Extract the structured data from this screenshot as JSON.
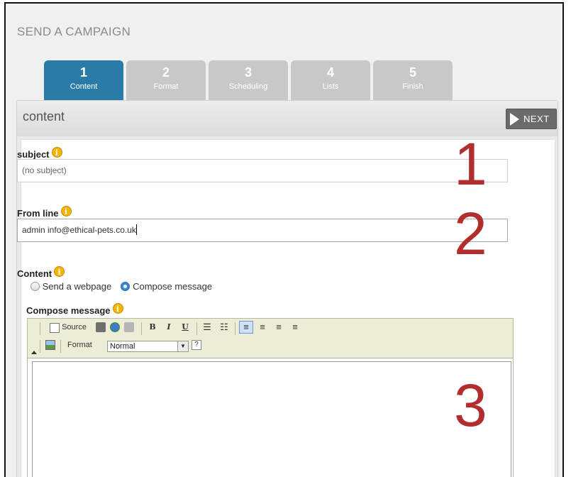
{
  "page": {
    "title": "SEND A CAMPAIGN"
  },
  "tabs": [
    {
      "num": "1",
      "label": "Content",
      "active": true
    },
    {
      "num": "2",
      "label": "Format",
      "active": false
    },
    {
      "num": "3",
      "label": "Scheduling",
      "active": false
    },
    {
      "num": "4",
      "label": "Lists",
      "active": false
    },
    {
      "num": "5",
      "label": "Finish",
      "active": false
    }
  ],
  "panel": {
    "title": "content",
    "next_label": "NEXT"
  },
  "subject": {
    "label": "subject",
    "info": "i",
    "placeholder": "(no subject)"
  },
  "from_line": {
    "label": "From line",
    "info": "i",
    "value": "admin info@ethical-pets.co.uk"
  },
  "content": {
    "label": "Content",
    "info": "i",
    "options": [
      {
        "label": "Send a webpage",
        "checked": false
      },
      {
        "label": "Compose message",
        "checked": true
      }
    ]
  },
  "compose": {
    "label": "Compose message",
    "info": "i"
  },
  "toolbar": {
    "source_label": "Source",
    "bold": "B",
    "italic": "I",
    "underline": "U",
    "format_label": "Format",
    "format_value": "Normal",
    "help": "?"
  },
  "annotations": [
    "1",
    "2",
    "3"
  ],
  "colors": {
    "active_tab": "#2b7ba8",
    "inactive_tab": "#c8c8c8",
    "annotation": "#b22d2d",
    "info_icon": "#f5b400"
  }
}
